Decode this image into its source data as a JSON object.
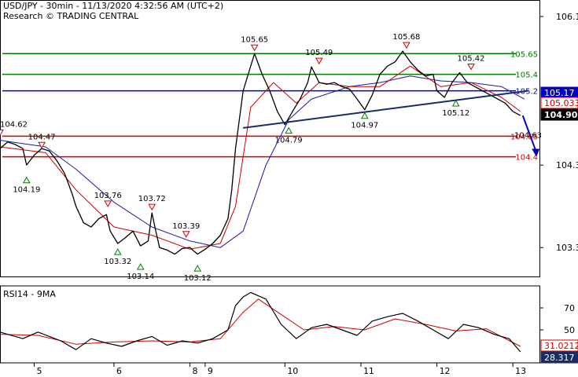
{
  "header": {
    "line1": "USD/JPY - 30min - 11/13/2020 4:32:56 AM (UTC+2)",
    "line2": "Research © TRADING CENTRAL"
  },
  "colors": {
    "green": "#007a00",
    "blue": "#0000c0",
    "red": "#d00000",
    "price": "#000000",
    "ma_red": "#cc0000",
    "ma_blue": "#1a1aa8",
    "rsi_black": "#000000",
    "rsi_red": "#cc0000",
    "tag_red": "#d00000",
    "tag_blue": "#0000c0",
    "tag_black": "#000000",
    "tag_navy": "#1a2c66"
  },
  "chart_data": [
    {
      "type": "line",
      "symbol": "USD/JPY",
      "timeframe": "30min",
      "ylim": [
        102.95,
        106.3
      ],
      "y_ticks": [
        106.1,
        104.3,
        103.3
      ],
      "x_ticks": [
        {
          "label": "5",
          "t": 0.45
        },
        {
          "label": "6",
          "t": 1.5
        },
        {
          "label": "8",
          "t": 2.5
        },
        {
          "label": "9",
          "t": 2.7
        },
        {
          "label": "10",
          "t": 3.75
        },
        {
          "label": "11",
          "t": 4.75
        },
        {
          "label": "12",
          "t": 5.75
        },
        {
          "label": "13",
          "t": 6.75
        }
      ],
      "series": [
        {
          "kind": "price",
          "points": [
            [
              0,
              104.5
            ],
            [
              0.1,
              104.58
            ],
            [
              0.2,
              104.55
            ],
            [
              0.3,
              104.5
            ],
            [
              0.35,
              104.3
            ],
            [
              0.45,
              104.42
            ],
            [
              0.55,
              104.5
            ],
            [
              0.65,
              104.47
            ],
            [
              0.75,
              104.35
            ],
            [
              0.85,
              104.2
            ],
            [
              0.95,
              103.95
            ],
            [
              1.0,
              103.8
            ],
            [
              1.1,
              103.6
            ],
            [
              1.2,
              103.55
            ],
            [
              1.3,
              103.65
            ],
            [
              1.4,
              103.7
            ],
            [
              1.45,
              103.5
            ],
            [
              1.55,
              103.35
            ],
            [
              1.65,
              103.42
            ],
            [
              1.75,
              103.5
            ],
            [
              1.85,
              103.32
            ],
            [
              1.95,
              103.38
            ],
            [
              2.0,
              103.72
            ],
            [
              2.05,
              103.5
            ],
            [
              2.1,
              103.3
            ],
            [
              2.2,
              103.27
            ],
            [
              2.3,
              103.22
            ],
            [
              2.4,
              103.29
            ],
            [
              2.5,
              103.3
            ],
            [
              2.6,
              103.22
            ],
            [
              2.7,
              103.28
            ],
            [
              2.8,
              103.35
            ],
            [
              2.9,
              103.45
            ],
            [
              3.0,
              103.65
            ],
            [
              3.05,
              104.0
            ],
            [
              3.1,
              104.5
            ],
            [
              3.2,
              105.2
            ],
            [
              3.3,
              105.5
            ],
            [
              3.35,
              105.65
            ],
            [
              3.45,
              105.4
            ],
            [
              3.55,
              105.2
            ],
            [
              3.65,
              104.95
            ],
            [
              3.75,
              104.79
            ],
            [
              3.85,
              104.95
            ],
            [
              3.95,
              105.1
            ],
            [
              4.05,
              105.3
            ],
            [
              4.1,
              105.49
            ],
            [
              4.2,
              105.3
            ],
            [
              4.3,
              105.28
            ],
            [
              4.4,
              105.3
            ],
            [
              4.5,
              105.25
            ],
            [
              4.6,
              105.22
            ],
            [
              4.7,
              105.1
            ],
            [
              4.8,
              104.97
            ],
            [
              4.9,
              105.15
            ],
            [
              5.0,
              105.4
            ],
            [
              5.1,
              105.5
            ],
            [
              5.2,
              105.55
            ],
            [
              5.3,
              105.68
            ],
            [
              5.4,
              105.55
            ],
            [
              5.5,
              105.45
            ],
            [
              5.6,
              105.38
            ],
            [
              5.7,
              105.4
            ],
            [
              5.75,
              105.2
            ],
            [
              5.85,
              105.12
            ],
            [
              5.95,
              105.3
            ],
            [
              6.05,
              105.42
            ],
            [
              6.15,
              105.3
            ],
            [
              6.25,
              105.25
            ],
            [
              6.35,
              105.2
            ],
            [
              6.45,
              105.15
            ],
            [
              6.55,
              105.1
            ],
            [
              6.65,
              105.05
            ],
            [
              6.75,
              104.95
            ],
            [
              6.85,
              104.9
            ]
          ]
        },
        {
          "kind": "ma_fast",
          "points": [
            [
              0,
              104.52
            ],
            [
              0.6,
              104.45
            ],
            [
              1.0,
              104.0
            ],
            [
              1.5,
              103.55
            ],
            [
              2.0,
              103.45
            ],
            [
              2.5,
              103.28
            ],
            [
              2.9,
              103.35
            ],
            [
              3.1,
              103.8
            ],
            [
              3.3,
              105.0
            ],
            [
              3.6,
              105.3
            ],
            [
              3.9,
              105.05
            ],
            [
              4.2,
              105.3
            ],
            [
              4.6,
              105.25
            ],
            [
              5.0,
              105.25
            ],
            [
              5.4,
              105.5
            ],
            [
              5.8,
              105.25
            ],
            [
              6.2,
              105.3
            ],
            [
              6.6,
              105.12
            ],
            [
              6.85,
              104.95
            ]
          ]
        },
        {
          "kind": "ma_slow",
          "points": [
            [
              0,
              104.6
            ],
            [
              0.6,
              104.52
            ],
            [
              1.0,
              104.25
            ],
            [
              1.5,
              103.85
            ],
            [
              2.0,
              103.55
            ],
            [
              2.5,
              103.38
            ],
            [
              2.9,
              103.3
            ],
            [
              3.2,
              103.5
            ],
            [
              3.5,
              104.3
            ],
            [
              3.8,
              104.85
            ],
            [
              4.1,
              105.1
            ],
            [
              4.6,
              105.25
            ],
            [
              5.0,
              105.3
            ],
            [
              5.4,
              105.38
            ],
            [
              5.8,
              105.32
            ],
            [
              6.2,
              105.3
            ],
            [
              6.6,
              105.25
            ],
            [
              6.9,
              105.1
            ]
          ]
        }
      ],
      "levels": [
        {
          "value": 105.65,
          "label": "105.65",
          "color": "green"
        },
        {
          "value": 105.4,
          "label": "105.4",
          "color": "green"
        },
        {
          "value": 105.2,
          "label": "105.2",
          "color": "blue"
        },
        {
          "value": 104.65,
          "label": "104.65",
          "color": "red"
        },
        {
          "value": 104.4,
          "label": "104.4",
          "color": "red"
        }
      ],
      "price_tags": [
        {
          "value": 105.17,
          "label": "105.17",
          "style": "blue"
        },
        {
          "value": 105.033,
          "label": "105.033",
          "style": "red"
        },
        {
          "value": 104.901,
          "label": "104.901",
          "style": "black"
        }
      ],
      "trendline": [
        [
          3.2,
          104.75
        ],
        [
          6.95,
          105.2
        ]
      ],
      "projection_arrow": [
        [
          6.88,
          104.9
        ],
        [
          7.05,
          104.42
        ]
      ],
      "annotations": [
        {
          "t": 0.0,
          "v": 104.62,
          "label": "104.62",
          "marker": "high"
        },
        {
          "t": 0.55,
          "v": 104.47,
          "label": "104.47",
          "marker": "high"
        },
        {
          "t": 0.35,
          "v": 104.19,
          "label": "104.19",
          "marker": "low"
        },
        {
          "t": 1.42,
          "v": 103.76,
          "label": "103.76",
          "marker": "high"
        },
        {
          "t": 2.0,
          "v": 103.72,
          "label": "103.72",
          "marker": "high"
        },
        {
          "t": 2.45,
          "v": 103.39,
          "label": "103.39",
          "marker": "high"
        },
        {
          "t": 1.55,
          "v": 103.32,
          "label": "103.32",
          "marker": "low"
        },
        {
          "t": 1.85,
          "v": 103.14,
          "label": "103.14",
          "marker": "low"
        },
        {
          "t": 2.6,
          "v": 103.12,
          "label": "103.12",
          "marker": "low"
        },
        {
          "t": 3.35,
          "v": 105.65,
          "label": "105.65",
          "marker": "high"
        },
        {
          "t": 4.2,
          "v": 105.49,
          "label": "105.49",
          "marker": "high"
        },
        {
          "t": 5.35,
          "v": 105.68,
          "label": "105.68",
          "marker": "high"
        },
        {
          "t": 6.2,
          "v": 105.42,
          "label": "105.42",
          "marker": "high"
        },
        {
          "t": 3.8,
          "v": 104.79,
          "label": "104.79",
          "marker": "low"
        },
        {
          "t": 4.8,
          "v": 104.97,
          "label": "104.97",
          "marker": "low"
        },
        {
          "t": 6.0,
          "v": 105.12,
          "label": "105.12",
          "marker": "low"
        },
        {
          "t": 6.95,
          "v": 104.63,
          "label": "104.63",
          "marker": "none"
        }
      ]
    },
    {
      "type": "line",
      "title": "RSI14 - 9MA",
      "ylim": [
        20,
        90
      ],
      "y_ticks": [
        70,
        50
      ],
      "series": [
        {
          "kind": "rsi",
          "points": [
            [
              0,
              48
            ],
            [
              0.3,
              42
            ],
            [
              0.5,
              48
            ],
            [
              0.8,
              40
            ],
            [
              1.0,
              32
            ],
            [
              1.2,
              42
            ],
            [
              1.4,
              38
            ],
            [
              1.6,
              35
            ],
            [
              1.8,
              40
            ],
            [
              2.0,
              44
            ],
            [
              2.2,
              36
            ],
            [
              2.4,
              40
            ],
            [
              2.6,
              38
            ],
            [
              2.8,
              42
            ],
            [
              3.0,
              50
            ],
            [
              3.1,
              72
            ],
            [
              3.2,
              80
            ],
            [
              3.3,
              84
            ],
            [
              3.5,
              78
            ],
            [
              3.7,
              55
            ],
            [
              3.9,
              42
            ],
            [
              4.1,
              52
            ],
            [
              4.3,
              55
            ],
            [
              4.5,
              50
            ],
            [
              4.7,
              45
            ],
            [
              4.9,
              58
            ],
            [
              5.1,
              62
            ],
            [
              5.3,
              65
            ],
            [
              5.5,
              58
            ],
            [
              5.7,
              50
            ],
            [
              5.9,
              42
            ],
            [
              6.1,
              55
            ],
            [
              6.3,
              52
            ],
            [
              6.5,
              46
            ],
            [
              6.7,
              42
            ],
            [
              6.85,
              30
            ]
          ]
        },
        {
          "kind": "rsi_ma",
          "points": [
            [
              0,
              46
            ],
            [
              0.5,
              45
            ],
            [
              1.0,
              37
            ],
            [
              1.5,
              39
            ],
            [
              2.0,
              40
            ],
            [
              2.5,
              39
            ],
            [
              2.9,
              42
            ],
            [
              3.2,
              66
            ],
            [
              3.4,
              78
            ],
            [
              3.7,
              64
            ],
            [
              4.0,
              50
            ],
            [
              4.4,
              53
            ],
            [
              4.8,
              50
            ],
            [
              5.2,
              60
            ],
            [
              5.6,
              55
            ],
            [
              6.0,
              49
            ],
            [
              6.4,
              51
            ],
            [
              6.85,
              35
            ]
          ]
        }
      ],
      "value_tags": [
        {
          "value": 31.0212,
          "label": "31.0212",
          "style": "red"
        },
        {
          "value": 28.317,
          "label": "28.317",
          "style": "navy"
        }
      ]
    }
  ]
}
